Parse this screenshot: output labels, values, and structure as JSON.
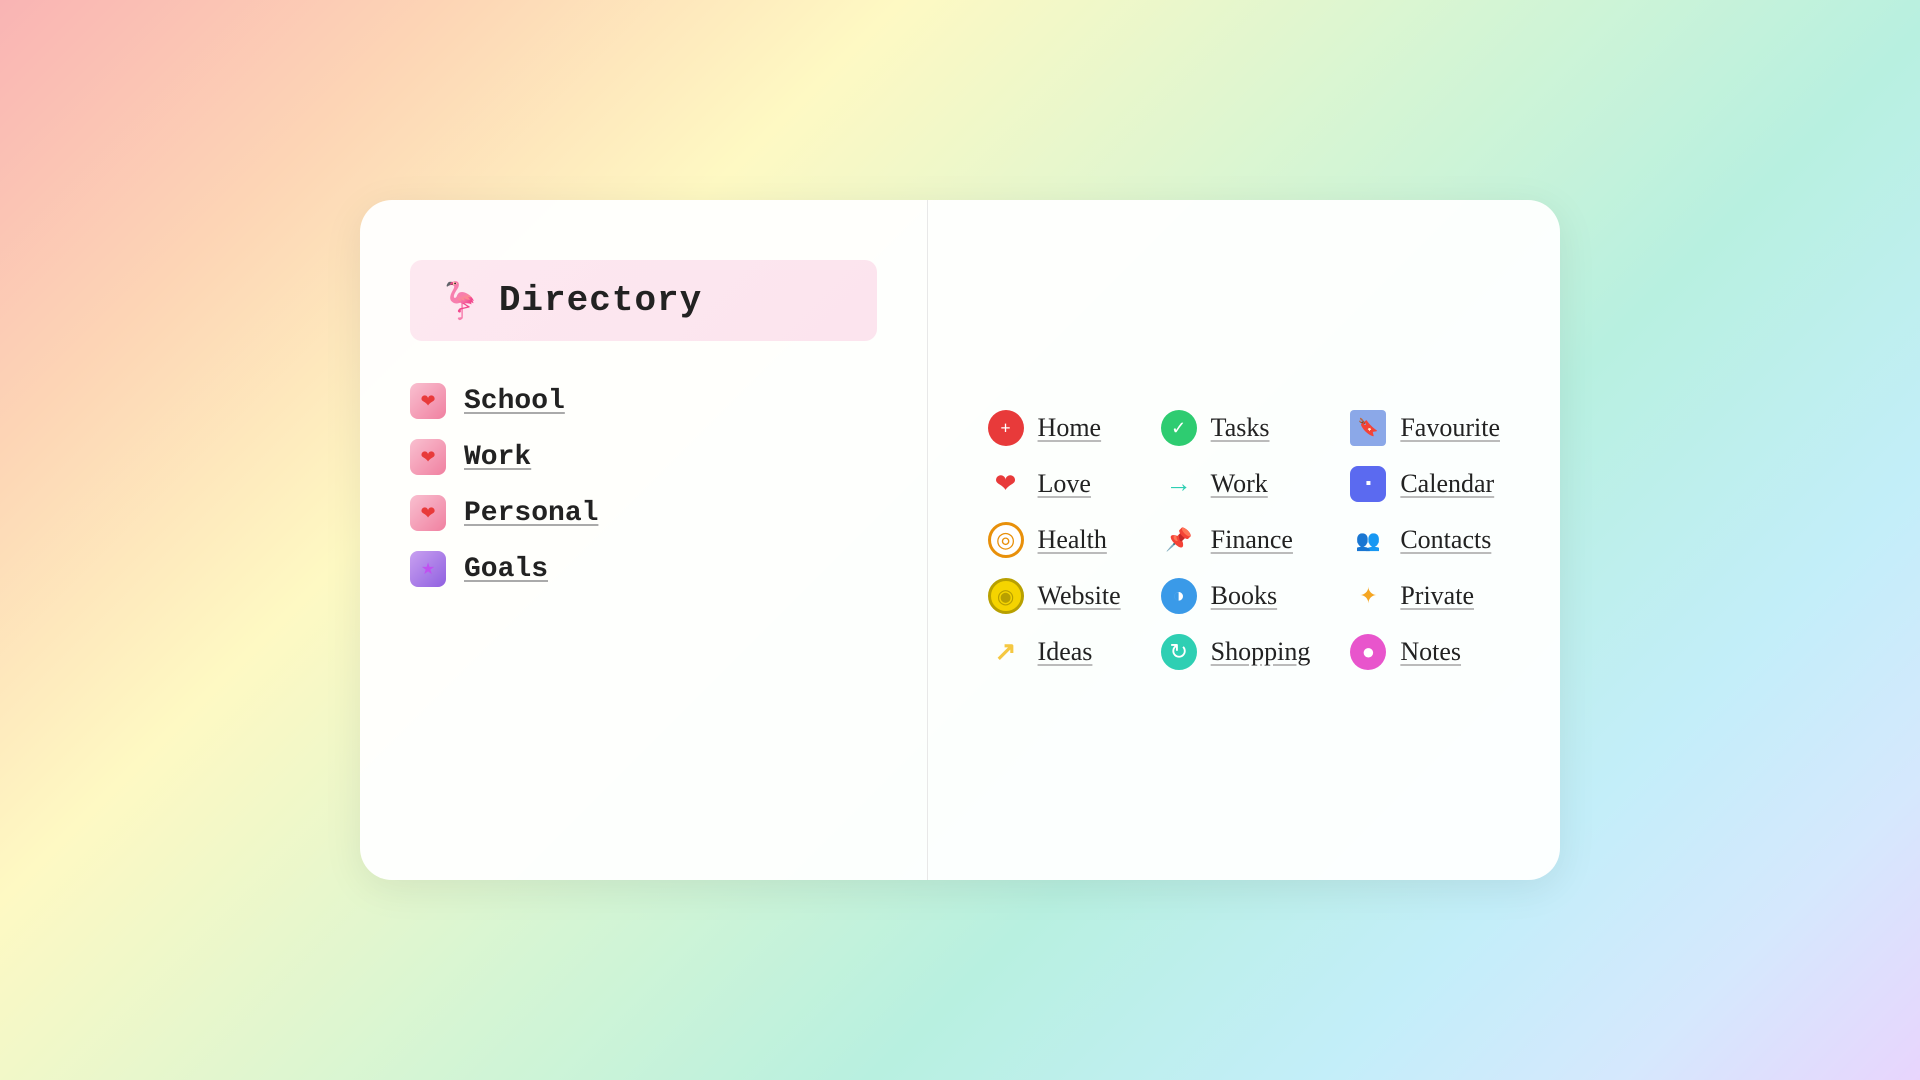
{
  "header": {
    "title": "Directory",
    "icon": "🦩"
  },
  "left_nav": {
    "items": [
      {
        "id": "school",
        "label": "School",
        "icon": "❤️",
        "icon_type": "nav"
      },
      {
        "id": "work",
        "label": "Work",
        "icon": "❤️",
        "icon_type": "nav"
      },
      {
        "id": "personal",
        "label": "Personal",
        "icon": "❤️",
        "icon_type": "nav"
      },
      {
        "id": "goals",
        "label": "Goals",
        "icon": "⭐",
        "icon_type": "nav-goals"
      }
    ]
  },
  "right_grid": {
    "items": [
      {
        "id": "home",
        "label": "Home",
        "icon": "➕",
        "icon_color": "red-plus"
      },
      {
        "id": "tasks",
        "label": "Tasks",
        "icon": "✔",
        "icon_color": "green-check"
      },
      {
        "id": "favourite",
        "label": "Favourite",
        "icon": "🔖",
        "icon_color": "bookmark-blue"
      },
      {
        "id": "love",
        "label": "Love",
        "icon": "❤",
        "icon_color": "heart"
      },
      {
        "id": "work",
        "label": "Work",
        "icon": "→",
        "icon_color": "arrow-cyan"
      },
      {
        "id": "calendar",
        "label": "Calendar",
        "icon": "▪",
        "icon_color": "calendar"
      },
      {
        "id": "health",
        "label": "Health",
        "icon": "◯",
        "icon_color": "orange"
      },
      {
        "id": "finance",
        "label": "Finance",
        "icon": "📌",
        "icon_color": "pin-red"
      },
      {
        "id": "contacts",
        "label": "Contacts",
        "icon": "👥",
        "icon_color": "contacts-blue"
      },
      {
        "id": "website",
        "label": "Website",
        "icon": "◎",
        "icon_color": "yellow"
      },
      {
        "id": "books",
        "label": "Books",
        "icon": "◑",
        "icon_color": "books-blue"
      },
      {
        "id": "private",
        "label": "Private",
        "icon": "✦",
        "icon_color": "star-orange"
      },
      {
        "id": "ideas",
        "label": "Ideas",
        "icon": "↗",
        "icon_color": "arrow-yellow"
      },
      {
        "id": "shopping",
        "label": "Shopping",
        "icon": "↻",
        "icon_color": "shopping-cyan"
      },
      {
        "id": "notes",
        "label": "Notes",
        "icon": "●",
        "icon_color": "notes"
      }
    ]
  }
}
